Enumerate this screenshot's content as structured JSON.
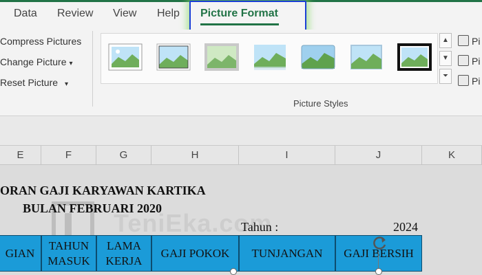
{
  "tabs": {
    "items": [
      {
        "label": "Data"
      },
      {
        "label": "Review"
      },
      {
        "label": "View"
      },
      {
        "label": "Help"
      }
    ],
    "active": {
      "label": "Picture Format"
    }
  },
  "ribbon": {
    "adjust": {
      "compress": "Compress Pictures",
      "change": "Change Picture",
      "reset": "Reset Picture"
    },
    "styles_label": "Picture Styles",
    "side_buttons": [
      "Pi",
      "Pi",
      "Pi"
    ]
  },
  "grid": {
    "columns": [
      "E",
      "F",
      "G",
      "H",
      "I",
      "J",
      "K"
    ]
  },
  "sheet": {
    "title_line1": "ORAN GAJI KARYAWAN KARTIKA",
    "title_line2": "BULAN FEBRUARI 2020",
    "year_label": "Tahun :",
    "year_value": "2024",
    "headers": [
      "GIAN",
      "TAHUN MASUK",
      "LAMA KERJA",
      "GAJI POKOK",
      "TUNJANGAN",
      "GAJI BERSIH"
    ],
    "watermark": "TeniEka.com"
  },
  "colors": {
    "accent": "#217346",
    "highlight_border": "#1a3fd6",
    "table_header": "#1b9bd8"
  },
  "icons": [
    "picture-style-thumb",
    "gallery-up-icon",
    "gallery-down-icon",
    "gallery-more-icon",
    "rotate-handle-icon",
    "resize-handle-icon"
  ]
}
